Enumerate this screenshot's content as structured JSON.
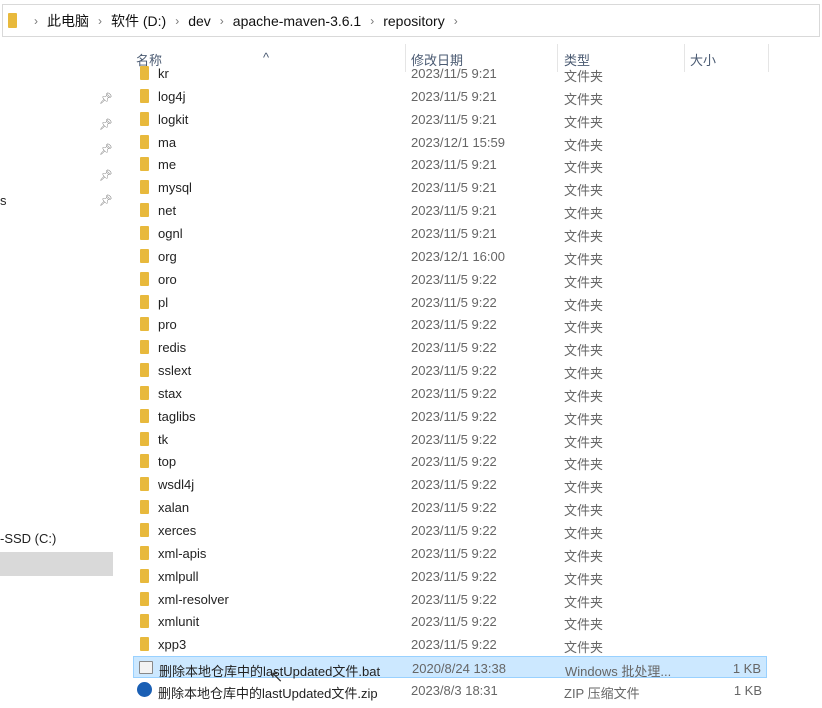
{
  "breadcrumb": [
    "此电脑",
    "软件 (D:)",
    "dev",
    "apache-maven-3.6.1",
    "repository"
  ],
  "left_pane": {
    "partial_item": "s",
    "drive": "-SSD (C:)"
  },
  "columns": {
    "name": "名称",
    "date": "修改日期",
    "type": "类型",
    "size": "大小"
  },
  "files": [
    {
      "name": "kr",
      "date": "2023/11/5 9:21",
      "type": "文件夹",
      "size": "",
      "icon": "folder-icon"
    },
    {
      "name": "log4j",
      "date": "2023/11/5 9:21",
      "type": "文件夹",
      "size": "",
      "icon": "folder-icon"
    },
    {
      "name": "logkit",
      "date": "2023/11/5 9:21",
      "type": "文件夹",
      "size": "",
      "icon": "folder-icon"
    },
    {
      "name": "ma",
      "date": "2023/12/1 15:59",
      "type": "文件夹",
      "size": "",
      "icon": "folder-icon"
    },
    {
      "name": "me",
      "date": "2023/11/5 9:21",
      "type": "文件夹",
      "size": "",
      "icon": "folder-icon"
    },
    {
      "name": "mysql",
      "date": "2023/11/5 9:21",
      "type": "文件夹",
      "size": "",
      "icon": "folder-icon"
    },
    {
      "name": "net",
      "date": "2023/11/5 9:21",
      "type": "文件夹",
      "size": "",
      "icon": "folder-icon"
    },
    {
      "name": "ognl",
      "date": "2023/11/5 9:21",
      "type": "文件夹",
      "size": "",
      "icon": "folder-icon"
    },
    {
      "name": "org",
      "date": "2023/12/1 16:00",
      "type": "文件夹",
      "size": "",
      "icon": "folder-icon"
    },
    {
      "name": "oro",
      "date": "2023/11/5 9:22",
      "type": "文件夹",
      "size": "",
      "icon": "folder-icon"
    },
    {
      "name": "pl",
      "date": "2023/11/5 9:22",
      "type": "文件夹",
      "size": "",
      "icon": "folder-icon"
    },
    {
      "name": "pro",
      "date": "2023/11/5 9:22",
      "type": "文件夹",
      "size": "",
      "icon": "folder-icon"
    },
    {
      "name": "redis",
      "date": "2023/11/5 9:22",
      "type": "文件夹",
      "size": "",
      "icon": "folder-icon"
    },
    {
      "name": "sslext",
      "date": "2023/11/5 9:22",
      "type": "文件夹",
      "size": "",
      "icon": "folder-icon"
    },
    {
      "name": "stax",
      "date": "2023/11/5 9:22",
      "type": "文件夹",
      "size": "",
      "icon": "folder-icon"
    },
    {
      "name": "taglibs",
      "date": "2023/11/5 9:22",
      "type": "文件夹",
      "size": "",
      "icon": "folder-icon"
    },
    {
      "name": "tk",
      "date": "2023/11/5 9:22",
      "type": "文件夹",
      "size": "",
      "icon": "folder-icon"
    },
    {
      "name": "top",
      "date": "2023/11/5 9:22",
      "type": "文件夹",
      "size": "",
      "icon": "folder-icon"
    },
    {
      "name": "wsdl4j",
      "date": "2023/11/5 9:22",
      "type": "文件夹",
      "size": "",
      "icon": "folder-icon"
    },
    {
      "name": "xalan",
      "date": "2023/11/5 9:22",
      "type": "文件夹",
      "size": "",
      "icon": "folder-icon"
    },
    {
      "name": "xerces",
      "date": "2023/11/5 9:22",
      "type": "文件夹",
      "size": "",
      "icon": "folder-icon"
    },
    {
      "name": "xml-apis",
      "date": "2023/11/5 9:22",
      "type": "文件夹",
      "size": "",
      "icon": "folder-icon"
    },
    {
      "name": "xmlpull",
      "date": "2023/11/5 9:22",
      "type": "文件夹",
      "size": "",
      "icon": "folder-icon"
    },
    {
      "name": "xml-resolver",
      "date": "2023/11/5 9:22",
      "type": "文件夹",
      "size": "",
      "icon": "folder-icon"
    },
    {
      "name": "xmlunit",
      "date": "2023/11/5 9:22",
      "type": "文件夹",
      "size": "",
      "icon": "folder-icon"
    },
    {
      "name": "xpp3",
      "date": "2023/11/5 9:22",
      "type": "文件夹",
      "size": "",
      "icon": "folder-icon"
    },
    {
      "name": "删除本地仓库中的lastUpdated文件.bat",
      "date": "2020/8/24 13:38",
      "type": "Windows 批处理...",
      "size": "1 KB",
      "icon": "batch-file-icon",
      "selected": true
    },
    {
      "name": "删除本地仓库中的lastUpdated文件.zip",
      "date": "2023/8/3 18:31",
      "type": "ZIP 压缩文件",
      "size": "1 KB",
      "icon": "zip-file-icon"
    }
  ]
}
